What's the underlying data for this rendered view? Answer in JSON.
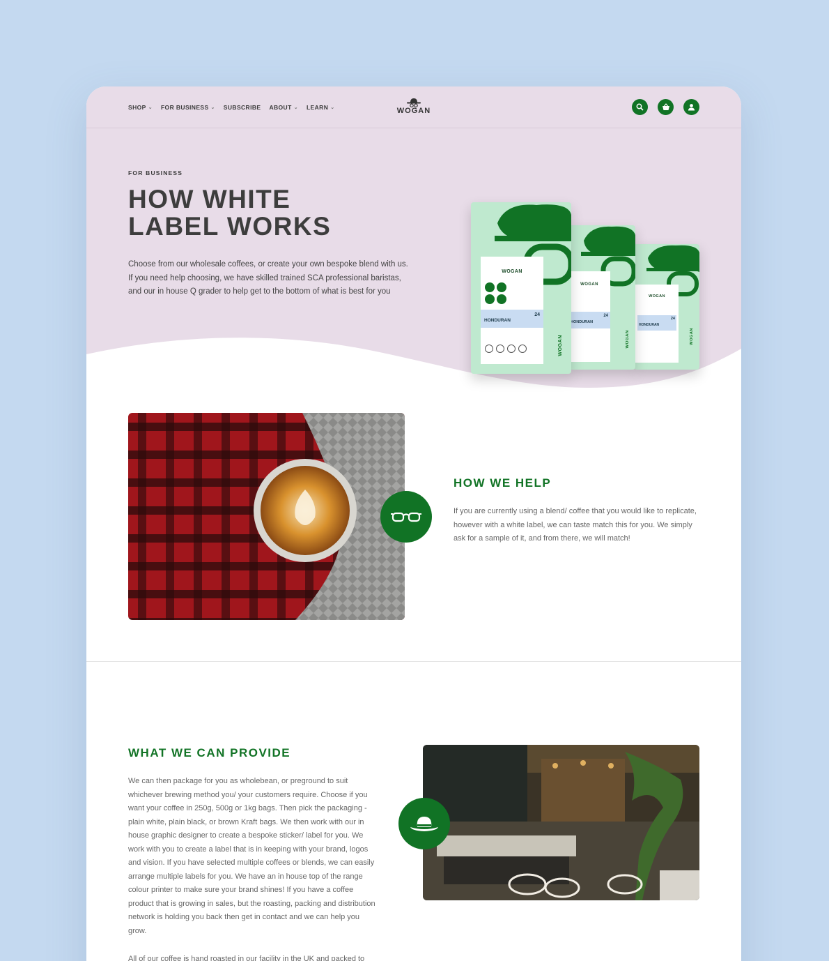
{
  "nav": {
    "items": [
      {
        "label": "SHOP",
        "has_dropdown": true
      },
      {
        "label": "FOR BUSINESS",
        "has_dropdown": true
      },
      {
        "label": "SUBSCRIBE",
        "has_dropdown": false
      },
      {
        "label": "ABOUT",
        "has_dropdown": true
      },
      {
        "label": "LEARN",
        "has_dropdown": true
      }
    ],
    "logo_text": "WOGAN",
    "icons": [
      "search-icon",
      "basket-icon",
      "account-icon"
    ]
  },
  "hero": {
    "eyebrow": "FOR BUSINESS",
    "title_line1": "HOW WHITE",
    "title_line2": "LABEL WORKS",
    "text": "Choose from our wholesale coffees, or create your own bespoke blend with us. If you need help choosing, we have skilled trained SCA professional baristas, and our in house Q grader to help get to the bottom of what is best for you",
    "bag_brand": "WOGAN",
    "bag_name": "HONDURAN",
    "bag_number": "24",
    "bag_vertical": "WOGAN"
  },
  "help": {
    "title": "HOW WE HELP",
    "text": "If you are currently using a blend/ coffee that you would like to replicate, however with a white label, we can taste match this for you. We simply ask for a sample of it, and from there, we will match!",
    "badge_icon": "glasses-icon"
  },
  "provide": {
    "title": "WHAT WE CAN PROVIDE",
    "text": "We can then package for you as wholebean, or preground to suit whichever brewing method you/ your customers require. Choose if you want your coffee in 250g, 500g or 1kg bags. Then pick the packaging - plain white, plain black, or brown Kraft bags. We then work with our in house graphic designer to create a bespoke sticker/ label for you. We work with you to create a label that is in keeping with your brand, logos and vision. If you have selected multiple coffees or blends, we can easily arrange multiple labels for you. We have an in house top of the range colour printer to make sure your brand shines! If you have a coffee product that is growing in sales, but the roasting, packing and distribution network is holding you back then get in contact and we can help you grow.",
    "text2": "All of our coffee is hand roasted in our facility in the UK and packed to",
    "badge_icon": "hat-icon"
  },
  "colors": {
    "brand_green": "#117325",
    "hero_pink": "#e8dce8",
    "page_bg": "#c4d9f0",
    "bag_mint": "#bfe9cf"
  }
}
